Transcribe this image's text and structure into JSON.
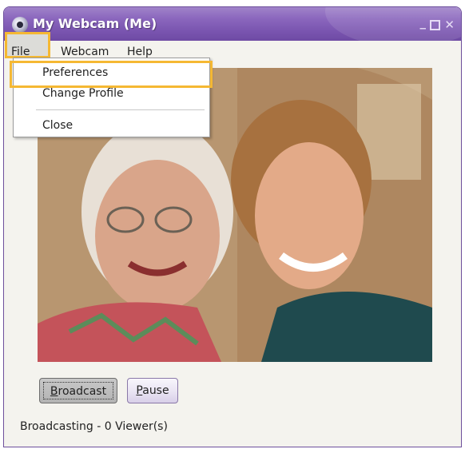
{
  "window": {
    "title": "My Webcam (Me)",
    "controls": [
      "minimize",
      "maximize",
      "close"
    ]
  },
  "menubar": {
    "file": "File",
    "webcam": "Webcam",
    "help": "Help"
  },
  "file_menu": {
    "items": [
      "Preferences",
      "Change Profile",
      "Close"
    ],
    "highlighted": "Preferences"
  },
  "video": {
    "description_hidden": true
  },
  "buttons": {
    "broadcast_label_first": "B",
    "broadcast_label_rest": "roadcast",
    "pause_label_first": "P",
    "pause_label_rest": "ause"
  },
  "status": {
    "text": "Broadcasting - 0 Viewer(s)"
  },
  "colors": {
    "titlebar": "#7a55b0",
    "highlight": "#f5b833"
  }
}
